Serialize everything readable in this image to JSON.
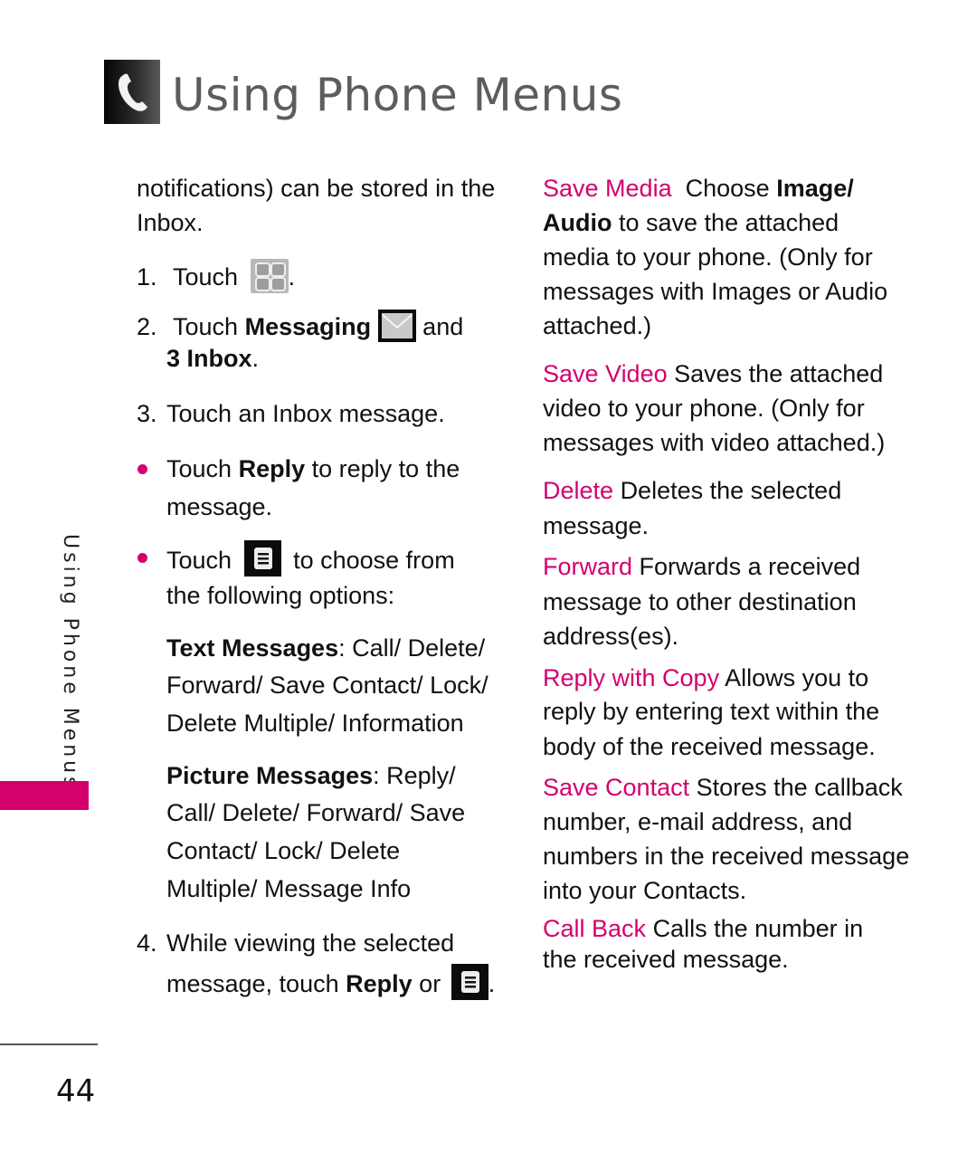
{
  "header": {
    "title": "Using Phone Menus",
    "icon": "phone-handset-icon"
  },
  "side_tab": {
    "label": "Using Phone Menus",
    "accent_color": "#d4006e"
  },
  "page_number": "44",
  "left_column": {
    "intro_line1": "notifications) can be stored in the",
    "intro_line2": "Inbox.",
    "step1": {
      "num": "1.",
      "text": "Touch",
      "icon": "menu-grid-icon",
      "after": "."
    },
    "step2": {
      "num": "2.",
      "text": "Touch",
      "bold": "Messaging",
      "icon": "envelope-icon",
      "after": "and",
      "line2_bold": "3 Inbox",
      "line2_after": "."
    },
    "step3": {
      "num": "3.",
      "text": "Touch an Inbox message."
    },
    "bullet1": {
      "pre": "Touch",
      "bold": "Reply",
      "post": "to reply to the",
      "line2": "message."
    },
    "bullet2": {
      "pre": "Touch",
      "icon": "options-menu-icon",
      "post": "to choose from",
      "line2": "the following options:"
    },
    "text_messages": {
      "label": "Text Messages",
      "lines": [
        ": Call/ Delete/",
        "Forward/ Save Contact/ Lock/",
        "Delete Multiple/ Information"
      ]
    },
    "picture_messages": {
      "label": "Picture Messages",
      "lines": [
        ": Reply/",
        "Call/ Delete/ Forward/ Save",
        "Contact/ Lock/ Delete",
        "Multiple/ Message Info"
      ]
    },
    "step4": {
      "num": "4.",
      "line1": "While viewing the selected",
      "pre": "message, touch",
      "bold": "Reply",
      "mid": "or",
      "icon": "options-menu-icon",
      "after": "."
    }
  },
  "right_column": {
    "save_media": {
      "term": "Save Media",
      "pre": "Choose",
      "bold1": "Image/",
      "bold2": "Audio",
      "post": "to save the attached",
      "lines": [
        "media to your phone. (Only for",
        "messages with Images or Audio",
        "attached.)"
      ]
    },
    "save_video": {
      "term": "Save Video",
      "text": "Saves the attached",
      "lines": [
        "video to your phone. (Only for",
        "messages with video attached.)"
      ]
    },
    "delete": {
      "term": "Delete",
      "text": "Deletes the selected",
      "lines": [
        "message."
      ]
    },
    "forward": {
      "term": "Forward",
      "text": "Forwards a received",
      "lines": [
        "message to other destination",
        "address(es)."
      ]
    },
    "reply_with_copy": {
      "term": "Reply with Copy",
      "text": "Allows you to",
      "lines": [
        "reply by entering text within the",
        "body of the received message."
      ]
    },
    "save_contact": {
      "term": "Save Contact",
      "text": "Stores the callback",
      "lines": [
        "number, e-mail address, and",
        "numbers in the received message",
        "into your Contacts."
      ]
    },
    "call_back": {
      "term": "Call Back",
      "text": "Calls the number in",
      "lines": [
        "the received message."
      ]
    }
  }
}
